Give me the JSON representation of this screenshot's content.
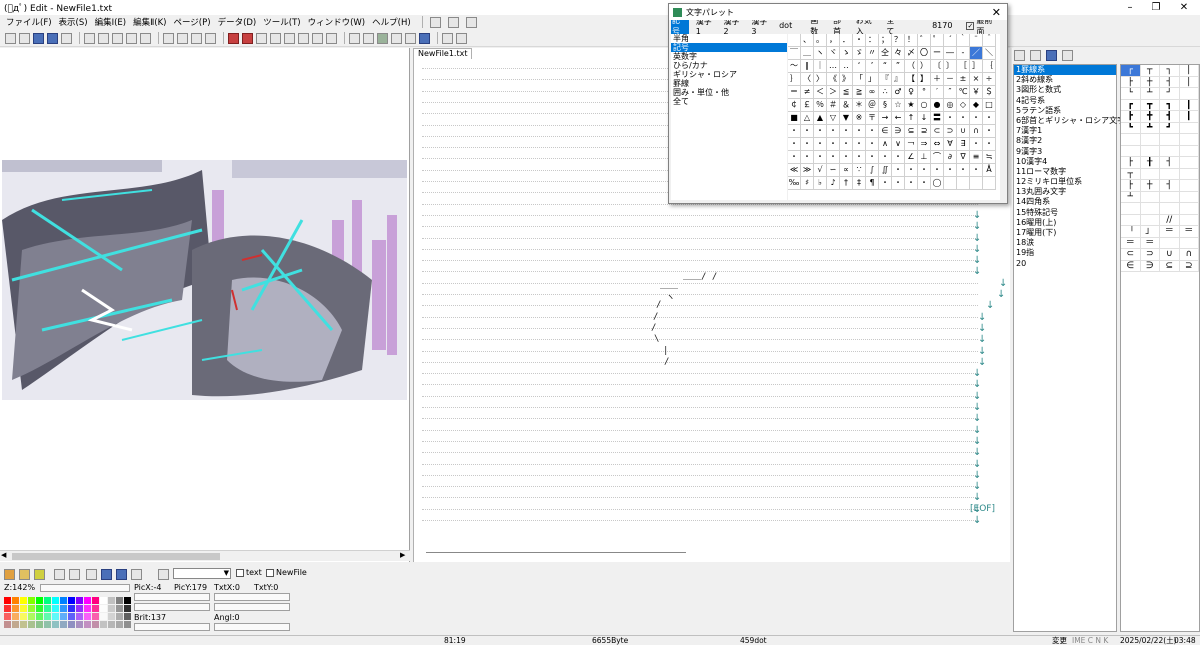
{
  "window": {
    "title": "(ﾟдﾟ) Edit - NewFile1.txt"
  },
  "menu": [
    "ファイル(F)",
    "表示(S)",
    "編集Ⅰ(E)",
    "編集Ⅱ(K)",
    "ページ(P)",
    "データ(D)",
    "ツール(T)",
    "ウィンドウ(W)",
    "ヘルプ(H)"
  ],
  "editor": {
    "tab": "NewFile1.txt",
    "eof": "[EOF]",
    "art": [
      "＿＿/ /",
      "＿＿",
      "ヽ",
      "/",
      "/",
      "/",
      "\\",
      "|",
      "/"
    ]
  },
  "palette": {
    "title": "文字パレット",
    "tabs": [
      "記号",
      "漢字1",
      "漢字2",
      "漢字3",
      "dot",
      "画数",
      "部首",
      "お気入",
      "全て"
    ],
    "code": "8170",
    "front_label": "最前面",
    "front_checked": true,
    "categories": [
      "半角",
      "記号",
      "英数字",
      "ひら/カナ",
      "ギリシャ・ロシア",
      "罫線",
      "囲み・単位・他",
      "全て"
    ],
    "selected_category": 1,
    "symbols": [
      "　",
      "、",
      "。",
      "，",
      "．",
      "・",
      "：",
      "；",
      "？",
      "！",
      "゛",
      "゜",
      "´",
      "｀",
      "¨",
      "＾",
      "￣",
      "＿",
      "ヽ",
      "ヾ",
      "ゝ",
      "ゞ",
      "〃",
      "仝",
      "々",
      "〆",
      "〇",
      "ー",
      "―",
      "‐",
      "／",
      "＼",
      "～",
      "∥",
      "｜",
      "…",
      "‥",
      "‘",
      "’",
      "“",
      "”",
      "（",
      "）",
      "〔",
      "〕",
      "［",
      "］",
      "｛",
      "｝",
      "〈",
      "〉",
      "《",
      "》",
      "「",
      "」",
      "『",
      "』",
      "【",
      "】",
      "＋",
      "－",
      "±",
      "×",
      "÷",
      "＝",
      "≠",
      "＜",
      "＞",
      "≦",
      "≧",
      "∞",
      "∴",
      "♂",
      "♀",
      "°",
      "′",
      "″",
      "℃",
      "￥",
      "＄",
      "￠",
      "￡",
      "％",
      "＃",
      "＆",
      "＊",
      "＠",
      "§",
      "☆",
      "★",
      "○",
      "●",
      "◎",
      "◇",
      "◆",
      "□",
      "■",
      "△",
      "▲",
      "▽",
      "▼",
      "※",
      "〒",
      "→",
      "←",
      "↑",
      "↓",
      "〓",
      "・",
      "・",
      "・",
      "・",
      "・",
      "・",
      "・",
      "・",
      "・",
      "・",
      "・",
      "∈",
      "∋",
      "⊆",
      "⊇",
      "⊂",
      "⊃",
      "∪",
      "∩",
      "・",
      "・",
      "・",
      "・",
      "・",
      "・",
      "・",
      "・",
      "∧",
      "∨",
      "￢",
      "⇒",
      "⇔",
      "∀",
      "∃",
      "・",
      "・",
      "・",
      "・",
      "・",
      "・",
      "・",
      "・",
      "・",
      "・",
      "・",
      "∠",
      "⊥",
      "⌒",
      "∂",
      "∇",
      "≡",
      "≒",
      "≪",
      "≫",
      "√",
      "∽",
      "∝",
      "∵",
      "∫",
      "∬",
      "・",
      "・",
      "・",
      "・",
      "・",
      "・",
      "・",
      "Å",
      "‰",
      "♯",
      "♭",
      "♪",
      "†",
      "‡",
      "¶",
      "・",
      "・",
      "・",
      "・",
      "◯",
      "",
      "",
      "",
      ""
    ]
  },
  "right_panel": {
    "categories": [
      "1罫線系",
      "2斜め線系",
      "3図形と数式",
      "4記号系",
      "5ラテン語系",
      "6部首とギリシャ・ロシア文字",
      "7漢字1",
      "8漢字2",
      "9漢字3",
      "10漢字4",
      "11ローマ数字",
      "12ミリキロ単位系",
      "13丸囲み文字",
      "14四角系",
      "15特殊記号",
      "16曜用(上)",
      "17曜用(下)",
      "18涙",
      "19指",
      "20"
    ],
    "selected": 0,
    "glyphs": [
      "┌",
      "┬",
      "┐",
      "│",
      "├",
      "┼",
      "┤",
      "│",
      "└",
      "┴",
      "┘",
      "",
      "┏",
      "┳",
      "┓",
      "┃",
      "┣",
      "╋",
      "┫",
      "┃",
      "┗",
      "┻",
      "┛",
      "",
      "",
      "",
      "",
      "",
      "",
      "",
      "",
      "",
      "├",
      "╂",
      "┤",
      "",
      "┬",
      "",
      "",
      "",
      "├",
      "┼",
      "┤",
      "",
      "┴",
      "",
      "",
      "",
      "",
      "",
      "",
      "",
      "",
      "",
      "//",
      "",
      "「",
      "」",
      "＝",
      "＝",
      "＝",
      "＝",
      "",
      "",
      "⊂",
      "⊃",
      "∪",
      "∩",
      "∈",
      "∋",
      "⊆",
      "⊇"
    ]
  },
  "bottom": {
    "text_label": "text",
    "newfile_label": "NewFile",
    "zoom": "Z:142%",
    "picx": "PicX:-4",
    "picy": "PicY:179",
    "txtx": "TxtX:0",
    "txty": "TxtY:0",
    "brit": "Brit:137",
    "angl": "Angl:0"
  },
  "status": {
    "pos": "81:19",
    "size": "6655Byte",
    "width": "459dot",
    "mode": "変更",
    "keys": "IME C N K",
    "date": "2025/02/22(土)",
    "time": "03:48"
  },
  "colors": {
    "accent": "#0078d7",
    "arrow": "#2f8a8a"
  }
}
